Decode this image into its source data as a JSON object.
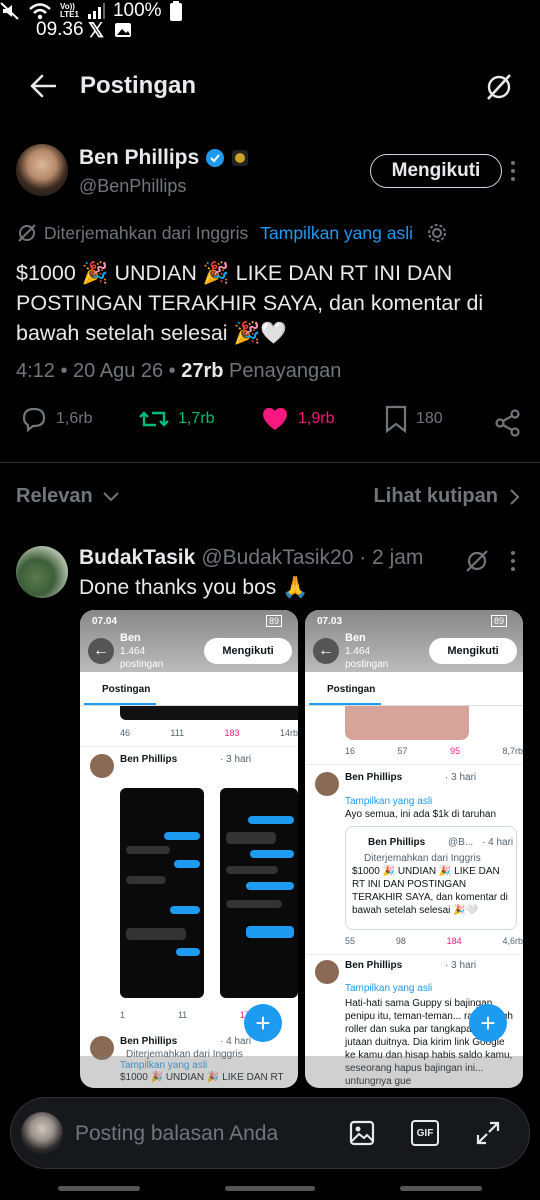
{
  "status_bar": {
    "time": "09.36",
    "battery": "100%",
    "network": "Vo))\nLTE1"
  },
  "header": {
    "title": "Postingan"
  },
  "author": {
    "name": "Ben Phillips",
    "handle": "@BenPhillips",
    "follow_label": "Mengikuti"
  },
  "translation": {
    "note": "Diterjemahkan dari Inggris",
    "show_original": "Tampilkan yang asli"
  },
  "tweet": {
    "text": "$1000 🎉 UNDIAN 🎉 LIKE DAN RT INI DAN POSTINGAN TERAKHIR SAYA, dan komentar di bawah setelah selesai 🎉🤍",
    "time": "4:12 • 20 Agu 26 • ",
    "views_count": "27rb",
    "views_label": " Penayangan"
  },
  "actions": {
    "replies": "1,6rb",
    "reposts": "1,7rb",
    "likes": "1,9rb",
    "bookmarks": "180"
  },
  "tabs": {
    "relevant": "Relevan",
    "quotes": "Lihat kutipan"
  },
  "reply": {
    "name": "BudakTasik",
    "handle": "@BudakTasik20 · 2 jam",
    "text": "Done thanks you bos 🙏"
  },
  "shot1": {
    "time": "07.04",
    "name": "Ben",
    "count": "1.464",
    "sub": "postingan",
    "follow": "Mengikuti",
    "tab": "Postingan",
    "battery": "89",
    "stats_top": [
      "46",
      "111",
      "183",
      "14rb"
    ],
    "post_name": "Ben Phillips",
    "post_time": "· 3 hari",
    "stats_bottom": [
      "1",
      "11",
      "17"
    ],
    "post2_name": "Ben Phillips",
    "post2_time": "· 4 hari",
    "post2_trans": "Diterjemahkan dari Inggris",
    "post2_show": "Tampilkan yang asli",
    "post2_text": "$1000 🎉 UNDIAN 🎉 LIKE DAN RT"
  },
  "shot2": {
    "time": "07.03",
    "name": "Ben",
    "count": "1.464",
    "sub": "postingan",
    "follow": "Mengikuti",
    "tab": "Postingan",
    "battery": "89",
    "stats_top": [
      "16",
      "57",
      "95",
      "8,7rb"
    ],
    "p1_name": "Ben Phillips",
    "p1_time": "· 3 hari",
    "p1_show": "Tampilkan yang asli",
    "p1_text": "Ayo semua, ini ada $1k di taruhan",
    "q_name": "Ben Phillips",
    "q_handle": "@B...",
    "q_time": "· 4 hari",
    "q_trans": "Diterjemahkan dari Inggris",
    "q_text": "$1000 🎉 UNDIAN 🎉 LIKE DAN RT INI DAN POSTINGAN TERAKHIR SAYA, dan komentar di bawah setelah selesai 🎉🤍",
    "stats_mid": [
      "55",
      "98",
      "184",
      "4,6rb"
    ],
    "p2_name": "Ben Phillips",
    "p2_time": "· 3 hari",
    "p2_show": "Tampilkan yang asli",
    "p2_text": "Hati-hati sama Guppy si bajingan penipu itu, teman-teman... ra jadi high roller dan suka par tangkapan layar jutaan duitnya. Dia kirim link Google ke kamu dan hisap habis saldo kamu, seseorang hapus bajingan ini... untungnya gue"
  },
  "compose": {
    "placeholder": "Posting balasan Anda",
    "gif": "GIF"
  },
  "colors": {
    "accent": "#1d9bf0",
    "like": "#f91880",
    "repost": "#00ba7c",
    "bg": "#000000"
  }
}
